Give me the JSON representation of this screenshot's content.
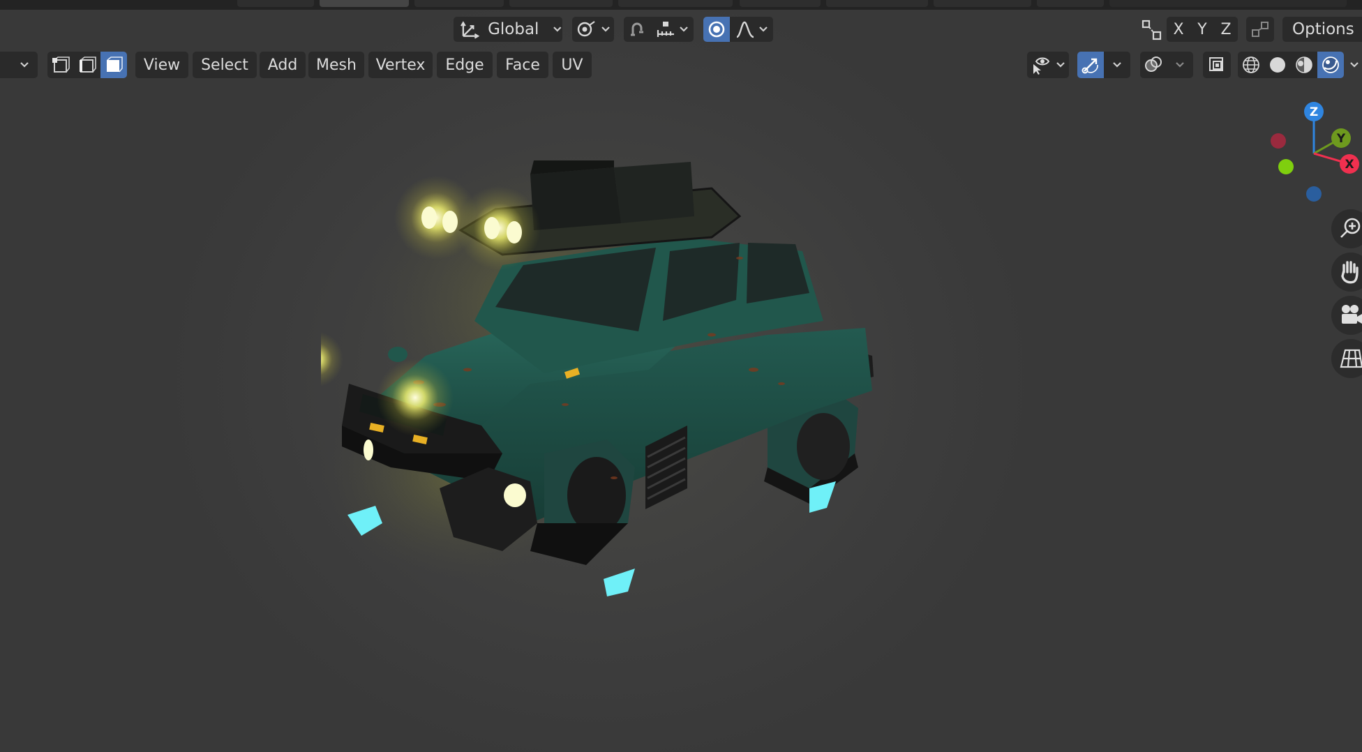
{
  "header": {
    "orientation_label": "Global",
    "axis_x": "X",
    "axis_y": "Y",
    "axis_z": "Z",
    "options_label": "Options"
  },
  "menu": {
    "items": [
      {
        "label": "View"
      },
      {
        "label": "Select"
      },
      {
        "label": "Add"
      },
      {
        "label": "Mesh"
      },
      {
        "label": "Vertex"
      },
      {
        "label": "Edge"
      },
      {
        "label": "Face"
      },
      {
        "label": "UV"
      }
    ]
  },
  "select_mode": {
    "active": "face"
  },
  "gizmo": {
    "x": "X",
    "y": "Y",
    "z": "Z",
    "colors": {
      "x": "#f0304f",
      "y": "#6e9a1e",
      "z": "#2f85e0",
      "x_neg": "#9a2a3e",
      "y_neg": "#7fcf0e",
      "z_neg": "#2a5e9e"
    }
  },
  "icons": [
    "transform-pivot-icon",
    "snap-icon",
    "proportional-editing-icon",
    "falloff-curve-icon",
    "visibility-icon",
    "gizmo-toggle-icon",
    "overlay-icon",
    "xray-icon",
    "wireframe-shading-icon",
    "solid-shading-icon",
    "material-preview-icon",
    "rendered-shading-icon",
    "zoom-icon",
    "hand-pan-icon",
    "camera-view-icon",
    "perspective-grid-icon"
  ],
  "colors": {
    "accent": "#4772b3",
    "headlight": "#e8e85a",
    "underglow": "#5fe8f0",
    "body": "#1f5048"
  }
}
